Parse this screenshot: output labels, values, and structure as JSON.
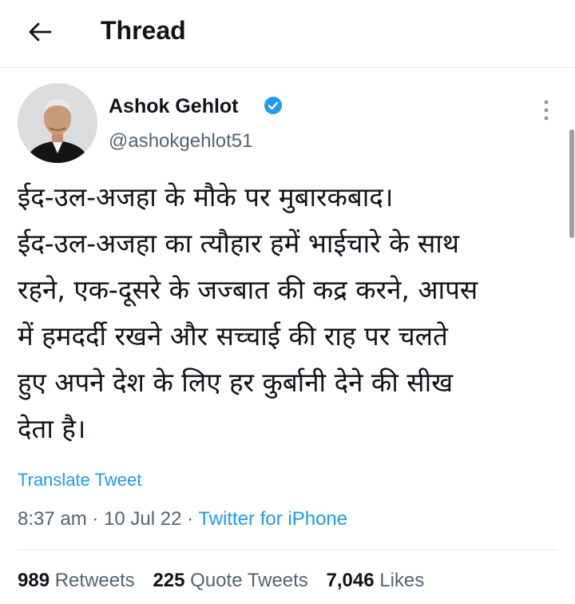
{
  "header": {
    "title": "Thread",
    "back_icon": "arrow-left-icon"
  },
  "tweet": {
    "author_name": "Ashok Gehlot",
    "handle": "@ashokgehlot51",
    "verified_icon": "verified-badge-icon",
    "text": "ईद-उल-अजहा के मौके पर मुबारकबाद।\nईद-उल-अजहा का त्यौहार हमें भाईचारे के साथ\nरहने, एक-दूसरे के जज्बात की कद्र करने, आपस\nमें हमदर्दी रखने और सच्चाई की राह पर चलते\nहुए अपने देश के लिए हर कुर्बानी देने की सीख\nदेता है।",
    "translate_label": "Translate Tweet",
    "time": "8:37 am",
    "date": "10 Jul 22",
    "separator": "·",
    "source": "Twitter for iPhone"
  },
  "stats": {
    "retweets_count": "989",
    "retweets_label": "Retweets",
    "quotes_count": "225",
    "quotes_label": "Quote Tweets",
    "likes_count": "7,046",
    "likes_label": "Likes"
  },
  "colors": {
    "accent": "#1d9bf0",
    "secondary_text": "#536471",
    "primary_text": "#0f1419",
    "divider": "#e6e9ec"
  }
}
